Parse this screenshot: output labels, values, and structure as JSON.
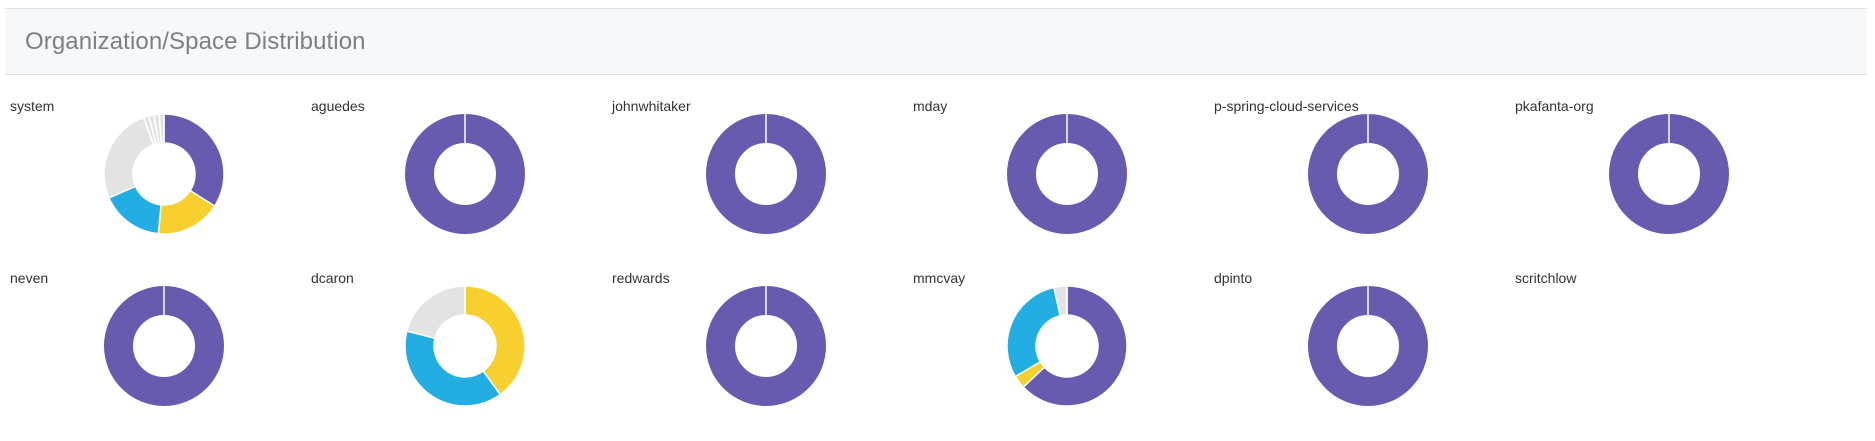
{
  "panel": {
    "title": "Organization/Space Distribution"
  },
  "colors": {
    "purple": "#675bb0",
    "yellow": "#f7cf2f",
    "blue": "#22ade3",
    "gray": "#e3e3e3",
    "separator": "#ffffff"
  },
  "chart_data": [
    {
      "type": "pie",
      "title": "system",
      "donut": true,
      "values": [
        34,
        17.5,
        17,
        26,
        1.4,
        1.4,
        1.4,
        1.3
      ],
      "colors": [
        "#675bb0",
        "#f7cf2f",
        "#22ade3",
        "#e3e3e3",
        "#e3e3e3",
        "#e3e3e3",
        "#e3e3e3",
        "#e3e3e3"
      ]
    },
    {
      "type": "pie",
      "title": "aguedes",
      "donut": true,
      "values": [
        100
      ],
      "colors": [
        "#675bb0"
      ]
    },
    {
      "type": "pie",
      "title": "johnwhitaker",
      "donut": true,
      "values": [
        100
      ],
      "colors": [
        "#675bb0"
      ]
    },
    {
      "type": "pie",
      "title": "mday",
      "donut": true,
      "values": [
        100
      ],
      "colors": [
        "#675bb0"
      ]
    },
    {
      "type": "pie",
      "title": "p-spring-cloud-services",
      "donut": true,
      "values": [
        100
      ],
      "colors": [
        "#675bb0"
      ]
    },
    {
      "type": "pie",
      "title": "pkafanta-org",
      "donut": true,
      "values": [
        100
      ],
      "colors": [
        "#675bb0"
      ]
    },
    {
      "type": "pie",
      "title": "neven",
      "donut": true,
      "values": [
        100
      ],
      "colors": [
        "#675bb0"
      ]
    },
    {
      "type": "pie",
      "title": "dcaron",
      "donut": true,
      "values": [
        40,
        39,
        21
      ],
      "colors": [
        "#f7cf2f",
        "#22ade3",
        "#e3e3e3"
      ]
    },
    {
      "type": "pie",
      "title": "redwards",
      "donut": true,
      "values": [
        100
      ],
      "colors": [
        "#675bb0"
      ]
    },
    {
      "type": "pie",
      "title": "mmcvay",
      "donut": true,
      "values": [
        63,
        3.5,
        30,
        3.5
      ],
      "colors": [
        "#675bb0",
        "#f7cf2f",
        "#22ade3",
        "#e3e3e3"
      ]
    },
    {
      "type": "pie",
      "title": "dpinto",
      "donut": true,
      "values": [
        100
      ],
      "colors": [
        "#675bb0"
      ]
    },
    {
      "type": "pie",
      "title": "scritchlow",
      "donut": true,
      "values": [],
      "colors": []
    }
  ]
}
